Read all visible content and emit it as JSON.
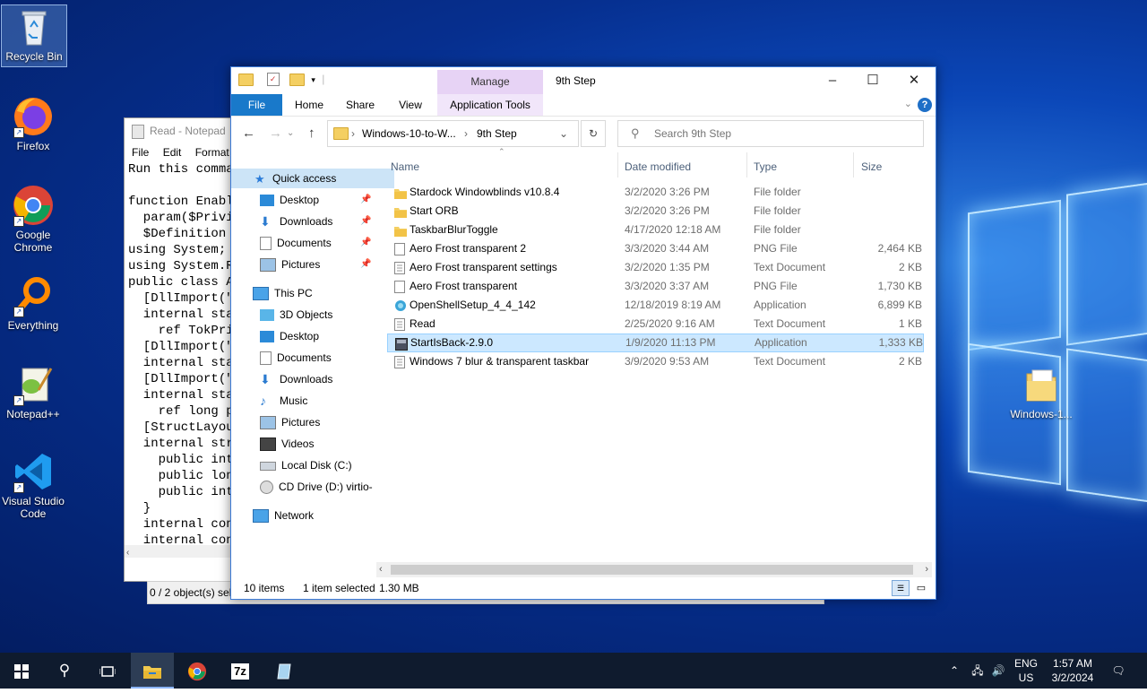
{
  "desktop": {
    "icons": [
      {
        "label": "Recycle Bin",
        "icon": "recycle-bin-icon"
      },
      {
        "label": "Firefox",
        "icon": "firefox-icon"
      },
      {
        "label": "Google Chrome",
        "icon": "chrome-icon"
      },
      {
        "label": "Everything",
        "icon": "everything-search-icon"
      },
      {
        "label": "Notepad++",
        "icon": "notepadpp-icon"
      },
      {
        "label": "Visual Studio Code",
        "icon": "vscode-icon"
      },
      {
        "label": "Windows-1...",
        "icon": "folder-icon"
      }
    ]
  },
  "notepad": {
    "title": "Read - Notepad",
    "menu": [
      "File",
      "Edit",
      "Format"
    ],
    "lines": [
      "Run this comman",
      "",
      "function Enable",
      "  param($Privil",
      "  $Definition =",
      "using System;",
      "using System.Ru",
      "public class Ad",
      "  [DllImport(\"a",
      "  internal stat",
      "    ref TokPriv",
      "  [DllImport(\"a",
      "  internal stat",
      "  [DllImport(\"a",
      "  internal stat",
      "    ref long pl",
      "  [StructLayout",
      "  internal stru",
      "    public int",
      "    public long",
      "    public int",
      "  }",
      "  internal cons",
      "  internal cons"
    ],
    "status": "0 / 2 object(s) sele"
  },
  "explorer": {
    "title": "9th Step",
    "manage_tab": "Manage",
    "tabs": {
      "file": "File",
      "home": "Home",
      "share": "Share",
      "view": "View",
      "app_tools": "Application Tools"
    },
    "help": "?",
    "address": {
      "crumb1": "Windows-10-to-W...",
      "crumb2": "9th Step"
    },
    "search_placeholder": "Search 9th Step",
    "nav": {
      "quick_access": "Quick access",
      "qa_items": [
        "Desktop",
        "Downloads",
        "Documents",
        "Pictures"
      ],
      "this_pc": "This PC",
      "pc_items": [
        "3D Objects",
        "Desktop",
        "Documents",
        "Downloads",
        "Music",
        "Pictures",
        "Videos",
        "Local Disk (C:)",
        "CD Drive (D:) virtio-"
      ],
      "network": "Network"
    },
    "columns": {
      "name": "Name",
      "date": "Date modified",
      "type": "Type",
      "size": "Size"
    },
    "files": [
      {
        "name": "Stardock Windowblinds v10.8.4",
        "date": "3/2/2020 3:26 PM",
        "type": "File folder",
        "size": "",
        "icon": "folder-icon"
      },
      {
        "name": "Start ORB",
        "date": "3/2/2020 3:26 PM",
        "type": "File folder",
        "size": "",
        "icon": "folder-icon"
      },
      {
        "name": "TaskbarBlurToggle",
        "date": "4/17/2020 12:18 AM",
        "type": "File folder",
        "size": "",
        "icon": "folder-icon"
      },
      {
        "name": "Aero Frost transparent 2",
        "date": "3/3/2020 3:44 AM",
        "type": "PNG File",
        "size": "2,464 KB",
        "icon": "image-file-icon"
      },
      {
        "name": "Aero Frost transparent settings",
        "date": "3/2/2020 1:35 PM",
        "type": "Text Document",
        "size": "2 KB",
        "icon": "text-file-icon"
      },
      {
        "name": "Aero Frost transparent",
        "date": "3/3/2020 3:37 AM",
        "type": "PNG File",
        "size": "1,730 KB",
        "icon": "image-file-icon"
      },
      {
        "name": "OpenShellSetup_4_4_142",
        "date": "12/18/2019 8:19 AM",
        "type": "Application",
        "size": "6,899 KB",
        "icon": "openshell-icon"
      },
      {
        "name": "Read",
        "date": "2/25/2020 9:16 AM",
        "type": "Text Document",
        "size": "1 KB",
        "icon": "text-file-icon"
      },
      {
        "name": "StartIsBack-2.9.0",
        "date": "1/9/2020 11:13 PM",
        "type": "Application",
        "size": "1,333 KB",
        "icon": "app-icon"
      },
      {
        "name": "Windows 7 blur & transparent taskbar",
        "date": "3/9/2020 9:53 AM",
        "type": "Text Document",
        "size": "2 KB",
        "icon": "text-file-icon"
      }
    ],
    "status": {
      "count": "10 items",
      "selected": "1 item selected",
      "size": "1.30 MB"
    }
  },
  "taskbar": {
    "items": [
      "start-icon",
      "search-icon",
      "task-view-icon",
      "file-explorer-icon",
      "chrome-icon",
      "7zip-icon",
      "notepad-icon"
    ],
    "sevenzip_label": "7z",
    "lang": "ENG",
    "region": "US",
    "time": "1:57 AM",
    "date": "3/2/2024"
  }
}
